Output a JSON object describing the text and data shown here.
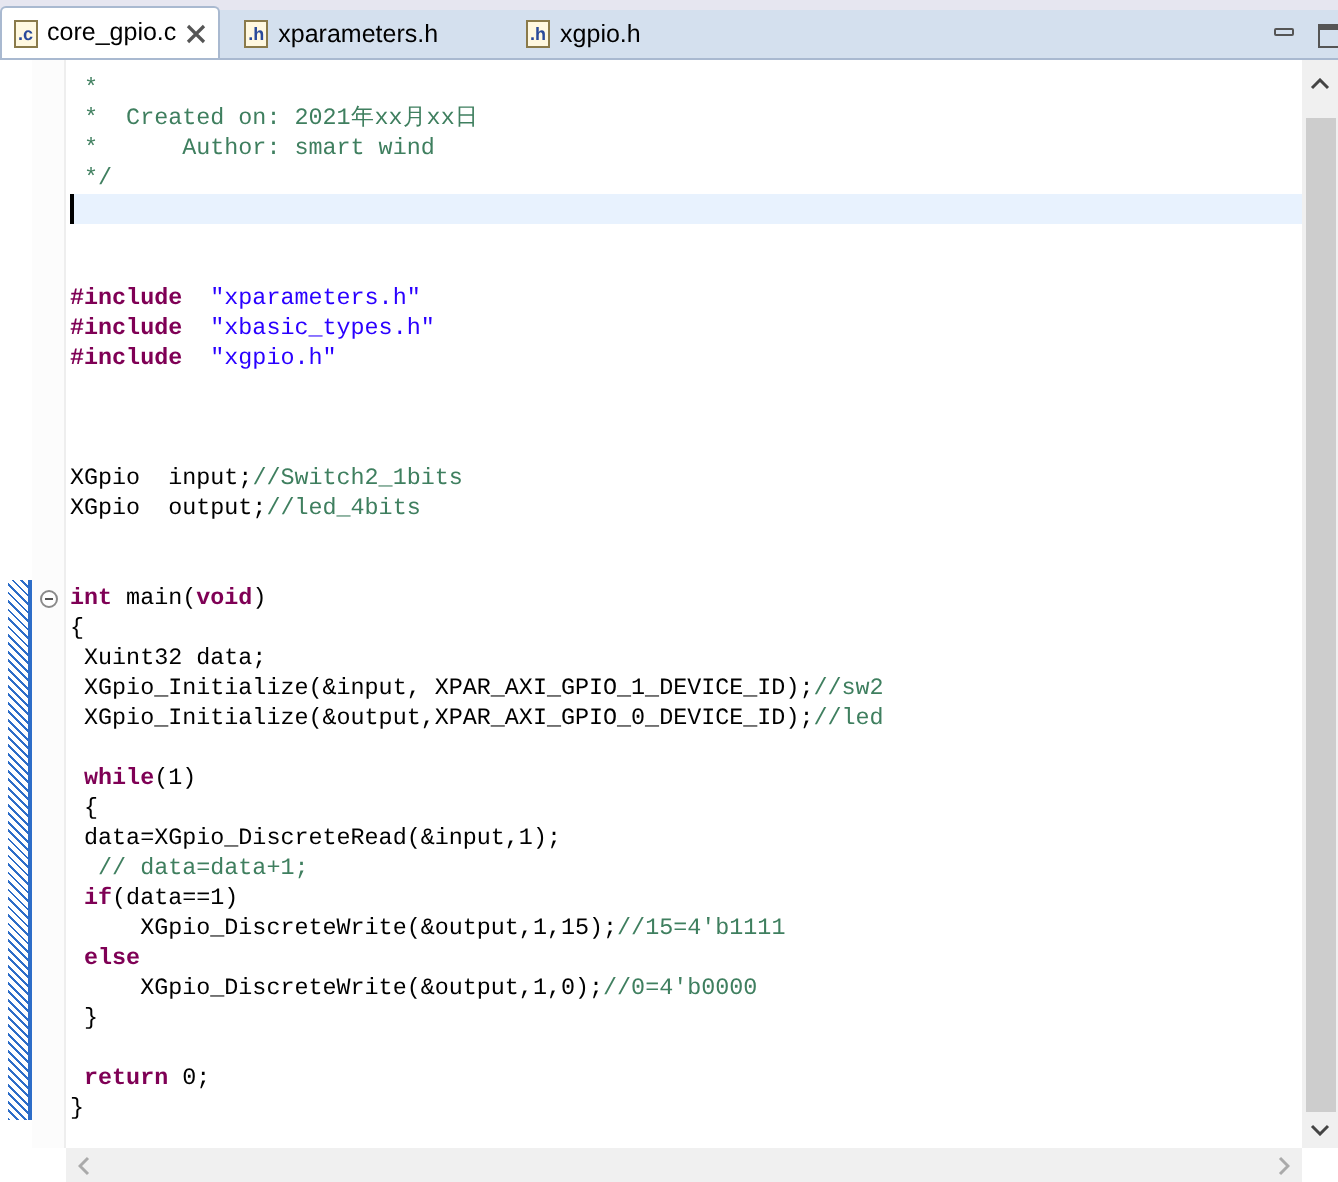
{
  "tabs": [
    {
      "icon": ".c",
      "label": "core_gpio.c",
      "selected": true,
      "closable": true
    },
    {
      "icon": ".h",
      "label": "xparameters.h",
      "selected": false,
      "closable": false
    },
    {
      "icon": ".h",
      "label": "xgpio.h",
      "selected": false,
      "closable": false
    }
  ],
  "editor": {
    "lines": [
      {
        "kind": "code",
        "tokens": [
          {
            "kind": "comment",
            "text": " *"
          }
        ]
      },
      {
        "kind": "code",
        "tokens": [
          {
            "kind": "comment",
            "text": " *  Created on: 2021年xx月xx日"
          }
        ]
      },
      {
        "kind": "code",
        "tokens": [
          {
            "kind": "comment",
            "text": " *      Author: smart wind"
          }
        ]
      },
      {
        "kind": "code",
        "tokens": [
          {
            "kind": "comment",
            "text": " */"
          }
        ]
      },
      {
        "kind": "blank",
        "current": true
      },
      {
        "kind": "blank"
      },
      {
        "kind": "blank"
      },
      {
        "kind": "code",
        "tokens": [
          {
            "kind": "keyword",
            "text": "#include"
          },
          {
            "kind": "string",
            "text": "  \"xparameters.h\""
          }
        ]
      },
      {
        "kind": "code",
        "tokens": [
          {
            "kind": "keyword",
            "text": "#include"
          },
          {
            "kind": "string",
            "text": "  \"xbasic_types.h\""
          }
        ]
      },
      {
        "kind": "code",
        "tokens": [
          {
            "kind": "keyword",
            "text": "#include"
          },
          {
            "kind": "string",
            "text": "  \"xgpio.h\""
          }
        ]
      },
      {
        "kind": "blank"
      },
      {
        "kind": "blank"
      },
      {
        "kind": "blank"
      },
      {
        "kind": "code",
        "tokens": [
          {
            "kind": "plain",
            "text": "XGpio  input;"
          },
          {
            "kind": "comment",
            "text": "//Switch2_1bits"
          }
        ]
      },
      {
        "kind": "code",
        "tokens": [
          {
            "kind": "plain",
            "text": "XGpio  output;"
          },
          {
            "kind": "comment",
            "text": "//led_4bits"
          }
        ]
      },
      {
        "kind": "blank"
      },
      {
        "kind": "blank"
      },
      {
        "kind": "code",
        "tokens": [
          {
            "kind": "keyword",
            "text": "int"
          },
          {
            "kind": "plain",
            "text": " main("
          },
          {
            "kind": "keyword",
            "text": "void"
          },
          {
            "kind": "plain",
            "text": ")"
          }
        ],
        "foldable": true
      },
      {
        "kind": "code",
        "tokens": [
          {
            "kind": "plain",
            "text": "{"
          }
        ]
      },
      {
        "kind": "code",
        "tokens": [
          {
            "kind": "plain",
            "text": " Xuint32 data;"
          }
        ]
      },
      {
        "kind": "code",
        "tokens": [
          {
            "kind": "plain",
            "text": " XGpio_Initialize(&input, XPAR_AXI_GPIO_1_DEVICE_ID);"
          },
          {
            "kind": "comment",
            "text": "//sw2"
          }
        ]
      },
      {
        "kind": "code",
        "tokens": [
          {
            "kind": "plain",
            "text": " XGpio_Initialize(&output,XPAR_AXI_GPIO_0_DEVICE_ID);"
          },
          {
            "kind": "comment",
            "text": "//led"
          }
        ]
      },
      {
        "kind": "blank"
      },
      {
        "kind": "code",
        "tokens": [
          {
            "kind": "keyword",
            "text": " while"
          },
          {
            "kind": "plain",
            "text": "(1)"
          }
        ]
      },
      {
        "kind": "code",
        "tokens": [
          {
            "kind": "plain",
            "text": " {"
          }
        ]
      },
      {
        "kind": "code",
        "tokens": [
          {
            "kind": "plain",
            "text": " data=XGpio_DiscreteRead(&input,1);"
          }
        ]
      },
      {
        "kind": "code",
        "tokens": [
          {
            "kind": "comment",
            "text": "  // data=data+1;"
          }
        ]
      },
      {
        "kind": "code",
        "tokens": [
          {
            "kind": "keyword",
            "text": " if"
          },
          {
            "kind": "plain",
            "text": "(data==1)"
          }
        ]
      },
      {
        "kind": "code",
        "tokens": [
          {
            "kind": "plain",
            "text": "     XGpio_DiscreteWrite(&output,1,15);"
          },
          {
            "kind": "comment",
            "text": "//15=4'b1111"
          }
        ]
      },
      {
        "kind": "code",
        "tokens": [
          {
            "kind": "keyword",
            "text": " else"
          }
        ]
      },
      {
        "kind": "code",
        "tokens": [
          {
            "kind": "plain",
            "text": "     XGpio_DiscreteWrite(&output,1,0);"
          },
          {
            "kind": "comment",
            "text": "//0=4'b0000"
          }
        ]
      },
      {
        "kind": "code",
        "tokens": [
          {
            "kind": "plain",
            "text": " }"
          }
        ]
      },
      {
        "kind": "blank"
      },
      {
        "kind": "code",
        "tokens": [
          {
            "kind": "keyword",
            "text": " return"
          },
          {
            "kind": "plain",
            "text": " 0;"
          }
        ]
      },
      {
        "kind": "code",
        "tokens": [
          {
            "kind": "plain",
            "text": "}"
          }
        ]
      }
    ]
  }
}
